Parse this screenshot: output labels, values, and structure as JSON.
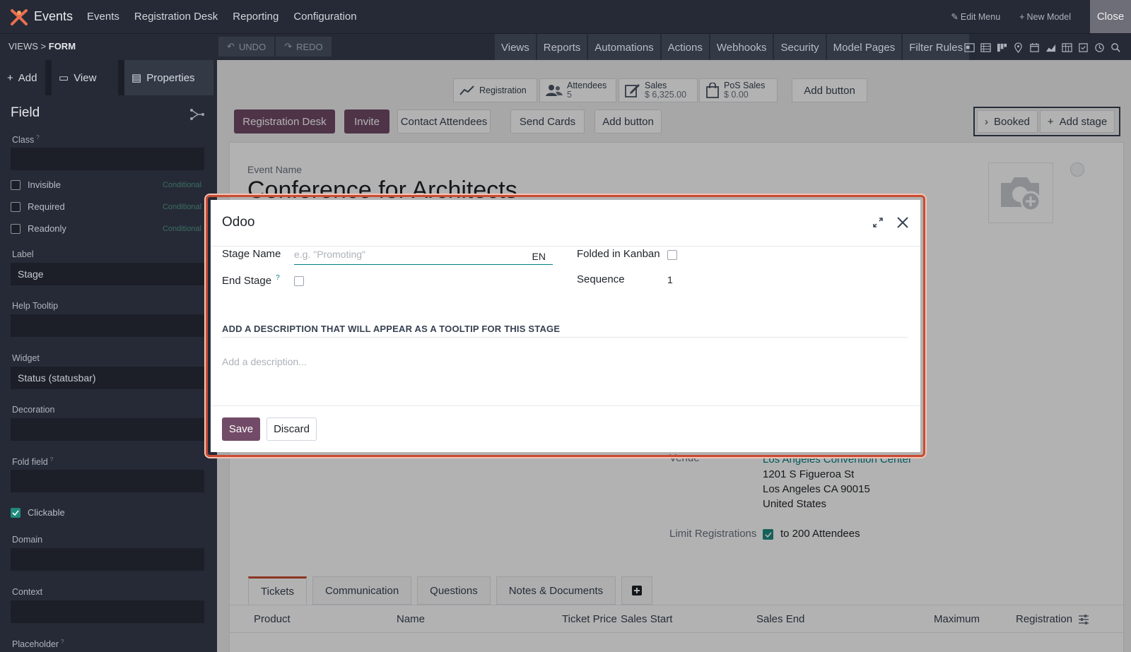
{
  "topbar": {
    "app_name": "Events",
    "menu": [
      "Events",
      "Registration Desk",
      "Reporting",
      "Configuration"
    ],
    "edit_menu": "Edit Menu",
    "new_model": "New Model",
    "close": "Close"
  },
  "subbar": {
    "breadcrumb_parent": "VIEWS",
    "breadcrumb_sep": ">",
    "breadcrumb_current": "FORM",
    "undo": "UNDO",
    "redo": "REDO",
    "tabs": [
      "Views",
      "Reports",
      "Automations",
      "Actions",
      "Webhooks",
      "Security",
      "Model Pages",
      "Filter Rules"
    ]
  },
  "sidebar": {
    "tabs": [
      "Add",
      "View",
      "Properties"
    ],
    "section_title": "Field",
    "class_label": "Class",
    "checks": [
      {
        "label": "Invisible",
        "cond": "Conditional",
        "checked": false
      },
      {
        "label": "Required",
        "cond": "Conditional",
        "checked": false
      },
      {
        "label": "Readonly",
        "cond": "Conditional",
        "checked": false
      }
    ],
    "label_label": "Label",
    "label_value": "Stage",
    "help_tooltip_label": "Help Tooltip",
    "widget_label": "Widget",
    "widget_value": "Status (statusbar)",
    "decoration_label": "Decoration",
    "fold_field_label": "Fold field",
    "clickable_label": "Clickable",
    "domain_label": "Domain",
    "context_label": "Context",
    "placeholder_label": "Placeholder"
  },
  "smart_buttons": {
    "registration": "Registration",
    "attendees_label": "Attendees",
    "attendees_value": "5",
    "sales_label": "Sales",
    "sales_value": "$ 6,325.00",
    "pos_label": "PoS Sales",
    "pos_value": "$ 0.00",
    "add_button": "Add button"
  },
  "header_buttons": [
    "Registration Desk",
    "Invite",
    "Contact Attendees",
    "Send Cards",
    "Add button"
  ],
  "statusbar": {
    "booked": "Booked",
    "add_stage": "Add stage"
  },
  "form": {
    "event_name_label": "Event Name",
    "event_name": "Conference for Architects",
    "venue_label": "Venue",
    "venue_name": "Los Angeles Convention Center",
    "venue_lines": [
      "1201 S Figueroa St",
      "Los Angeles CA 90015",
      "United States"
    ],
    "limit_label": "Limit Registrations",
    "limit_text": "to 200 Attendees"
  },
  "tabs": [
    "Tickets",
    "Communication",
    "Questions",
    "Notes & Documents"
  ],
  "table_columns": [
    "Product",
    "Name",
    "Ticket Price",
    "Sales Start",
    "Sales End",
    "Maximum",
    "Registration"
  ],
  "dialog": {
    "title": "Odoo",
    "stage_name_label": "Stage Name",
    "stage_name_placeholder": "e.g. \"Promoting\"",
    "lang": "EN",
    "end_stage_label": "End Stage",
    "help_mark": "?",
    "folded_label": "Folded in Kanban",
    "sequence_label": "Sequence",
    "sequence_value": "1",
    "desc_heading": "ADD A DESCRIPTION THAT WILL APPEAR AS A TOOLTIP FOR THIS STAGE",
    "desc_placeholder": "Add a description...",
    "save": "Save",
    "discard": "Discard"
  },
  "colors": {
    "brand": "#714b67",
    "accent": "#017e84",
    "highlight": "#c94c33"
  }
}
